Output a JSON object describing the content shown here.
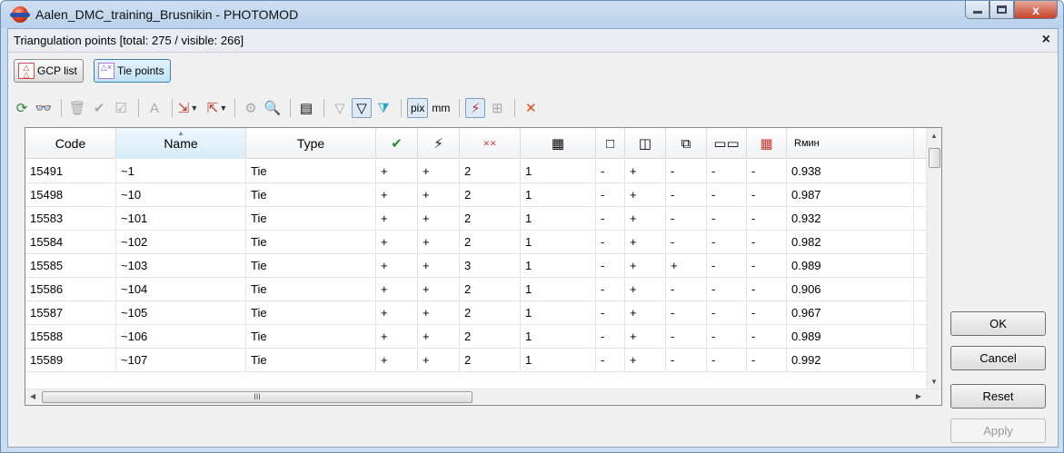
{
  "window": {
    "title": "Aalen_DMC_training_Brusnikin - PHOTOMOD",
    "close_glyph": "x"
  },
  "panel": {
    "title": "Triangulation points [total: 275 / visible: 266]",
    "close_glyph": "×"
  },
  "modes": {
    "gcp_label": "GCP list",
    "tie_label": "Tie points"
  },
  "toolbar": {
    "pix_label": "pix",
    "mm_label": "mm"
  },
  "table": {
    "columns": [
      {
        "label": "Code",
        "icon": null
      },
      {
        "label": "Name",
        "icon": null
      },
      {
        "label": "Type",
        "icon": null
      },
      {
        "label": "",
        "icon": "checkmark-icon",
        "glyph": "✔"
      },
      {
        "label": "",
        "icon": "lightning-icon",
        "glyph": "⚡"
      },
      {
        "label": "",
        "icon": "cross-grid-icon",
        "glyph": "✕✕"
      },
      {
        "label": "",
        "icon": "grid-blocks-icon",
        "glyph": "▦"
      },
      {
        "label": "",
        "icon": "single-frame-icon",
        "glyph": "□"
      },
      {
        "label": "",
        "icon": "double-frame-icon",
        "glyph": "◫"
      },
      {
        "label": "",
        "icon": "triple-frame-icon",
        "glyph": "⧉"
      },
      {
        "label": "",
        "icon": "row-blocks-icon",
        "glyph": "▭▭"
      },
      {
        "label": "",
        "icon": "red-grid-icon",
        "glyph": "▦"
      },
      {
        "label": "Rмин",
        "icon": null
      }
    ],
    "rows": [
      [
        "15491",
        "~1",
        "Tie",
        "+",
        "+",
        "2",
        "1",
        "-",
        "+",
        "-",
        "-",
        "-",
        "0.938"
      ],
      [
        "15498",
        "~10",
        "Tie",
        "+",
        "+",
        "2",
        "1",
        "-",
        "+",
        "-",
        "-",
        "-",
        "0.987"
      ],
      [
        "15583",
        "~101",
        "Tie",
        "+",
        "+",
        "2",
        "1",
        "-",
        "+",
        "-",
        "-",
        "-",
        "0.932"
      ],
      [
        "15584",
        "~102",
        "Tie",
        "+",
        "+",
        "2",
        "1",
        "-",
        "+",
        "-",
        "-",
        "-",
        "0.982"
      ],
      [
        "15585",
        "~103",
        "Tie",
        "+",
        "+",
        "3",
        "1",
        "-",
        "+",
        "+",
        "-",
        "-",
        "0.989"
      ],
      [
        "15586",
        "~104",
        "Tie",
        "+",
        "+",
        "2",
        "1",
        "-",
        "+",
        "-",
        "-",
        "-",
        "0.906"
      ],
      [
        "15587",
        "~105",
        "Tie",
        "+",
        "+",
        "2",
        "1",
        "-",
        "+",
        "-",
        "-",
        "-",
        "0.967"
      ],
      [
        "15588",
        "~106",
        "Tie",
        "+",
        "+",
        "2",
        "1",
        "-",
        "+",
        "-",
        "-",
        "-",
        "0.989"
      ],
      [
        "15589",
        "~107",
        "Tie",
        "+",
        "+",
        "2",
        "1",
        "-",
        "+",
        "-",
        "-",
        "-",
        "0.992"
      ]
    ]
  },
  "buttons": {
    "ok": "OK",
    "cancel": "Cancel",
    "reset": "Reset",
    "apply": "Apply"
  },
  "scroll": {
    "grip": "III"
  }
}
